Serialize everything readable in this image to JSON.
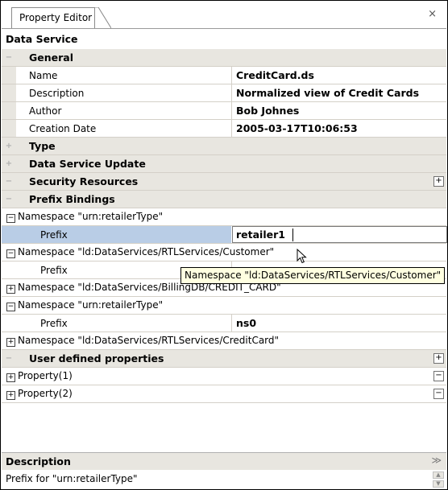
{
  "tab": {
    "title": "Property Editor",
    "close_glyph": "×"
  },
  "header": {
    "title": "Data Service"
  },
  "general": {
    "label": "General",
    "rows": [
      {
        "name": "Name",
        "value": "CreditCard.ds"
      },
      {
        "name": "Description",
        "value": "Normalized view of Credit Cards"
      },
      {
        "name": "Author",
        "value": "Bob Johnes"
      },
      {
        "name": "Creation Date",
        "value": "2005-03-17T10:06:53"
      }
    ]
  },
  "categories": {
    "type": "Type",
    "update": "Data Service Update",
    "security": "Security Resources",
    "prefix_bindings": "Prefix Bindings",
    "user_defined": "User defined properties"
  },
  "namespaces": [
    {
      "label": "Namespace \"urn:retailerType\"",
      "expanded": true,
      "prefix_label": "Prefix",
      "prefix_value": "retailer1"
    },
    {
      "label": "Namespace \"ld:DataServices/RTLServices/Customer\"",
      "expanded": true,
      "prefix_label": "Prefix",
      "prefix_value": ""
    },
    {
      "label": "Namespace \"ld:DataServices/BillingDB/CREDIT_CARD\"",
      "expanded": false
    },
    {
      "label": "Namespace \"urn:retailerType\"",
      "expanded": true,
      "prefix_label": "Prefix",
      "prefix_value": "ns0"
    },
    {
      "label": "Namespace \"ld:DataServices/RTLServices/CreditCard\"",
      "expanded": false
    }
  ],
  "tooltip": "Namespace \"ld:DataServices/RTLServices/Customer\"",
  "user_properties": [
    "Property(1)",
    "Property(2)"
  ],
  "glyphs": {
    "minus": "−",
    "plus": "+",
    "box_minus": "−",
    "box_plus": "+",
    "gutter_minus": "−",
    "gutter_plus": "+",
    "chevron": "≫"
  },
  "description": {
    "title": "Description",
    "text": "Prefix for \"urn:retailerType\""
  }
}
